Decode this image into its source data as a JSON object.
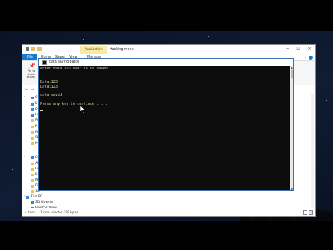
{
  "explorer": {
    "title": "Hacking menu",
    "contextual_tab": "Application Tools",
    "window_controls": {
      "minimize": "─",
      "maximize": "☐",
      "close": "✕"
    },
    "ribbon_tabs": [
      "File",
      "Home",
      "Share",
      "View",
      "Manage"
    ],
    "ribbon": {
      "pin_label_1": "Pin to Quick",
      "pin_label_2": "access"
    },
    "nav": {
      "back": "←",
      "forward": "→"
    },
    "sidebar": {
      "items": [
        {
          "label": "Quic",
          "icon": "star-icon",
          "color": "#3a86d4"
        },
        {
          "label": "De",
          "icon": "folder-icon",
          "color": "#3a86d4"
        },
        {
          "label": "Do",
          "icon": "folder-icon",
          "color": "#3a86d4"
        },
        {
          "label": "Do",
          "icon": "folder-icon",
          "color": "#3a86d4"
        },
        {
          "label": "Pic",
          "icon": "folder-icon",
          "color": "#e8c25a"
        },
        {
          "label": "Ne",
          "icon": "folder-icon",
          "color": "#e8c25a"
        },
        {
          "label": "Ro",
          "icon": "folder-icon",
          "color": "#e8c25a"
        },
        {
          "label": "Sh",
          "icon": "folder-icon",
          "color": "#e8c25a"
        },
        {
          "label": "Ne",
          "icon": "folder-icon",
          "color": "#e8c25a"
        },
        {
          "label": "One",
          "icon": "cloud-icon",
          "color": "#3a86d4"
        },
        {
          "label": "Att",
          "icon": "folder-icon",
          "color": "#e8c25a"
        },
        {
          "label": "De",
          "icon": "folder-icon",
          "color": "#e8c25a"
        },
        {
          "label": "Do",
          "icon": "folder-icon",
          "color": "#e8c25a"
        },
        {
          "label": "Mu",
          "icon": "folder-icon",
          "color": "#e8c25a"
        },
        {
          "label": "Pic",
          "icon": "folder-icon",
          "color": "#e8c25a"
        },
        {
          "label": "Sa",
          "icon": "folder-icon",
          "color": "#e8c25a"
        }
      ],
      "this_pc": "This PC",
      "objects_3d": "3D Objects",
      "partial": "Fourth Ollrow"
    },
    "status": {
      "items": "4 items",
      "selected": "1 item selected  208 bytes"
    }
  },
  "console": {
    "title": "data saving.batch",
    "lines": [
      "enter data you want to be saved.",
      "",
      "",
      "Data:123",
      "Data:123",
      "",
      "data saved",
      "",
      "Press any key to continue . . ."
    ]
  },
  "colors": {
    "accent": "#1979ca",
    "console_bg": "#0c0c0c",
    "console_text": "#c9c9a0",
    "context_tab": "#f7e9a6"
  }
}
